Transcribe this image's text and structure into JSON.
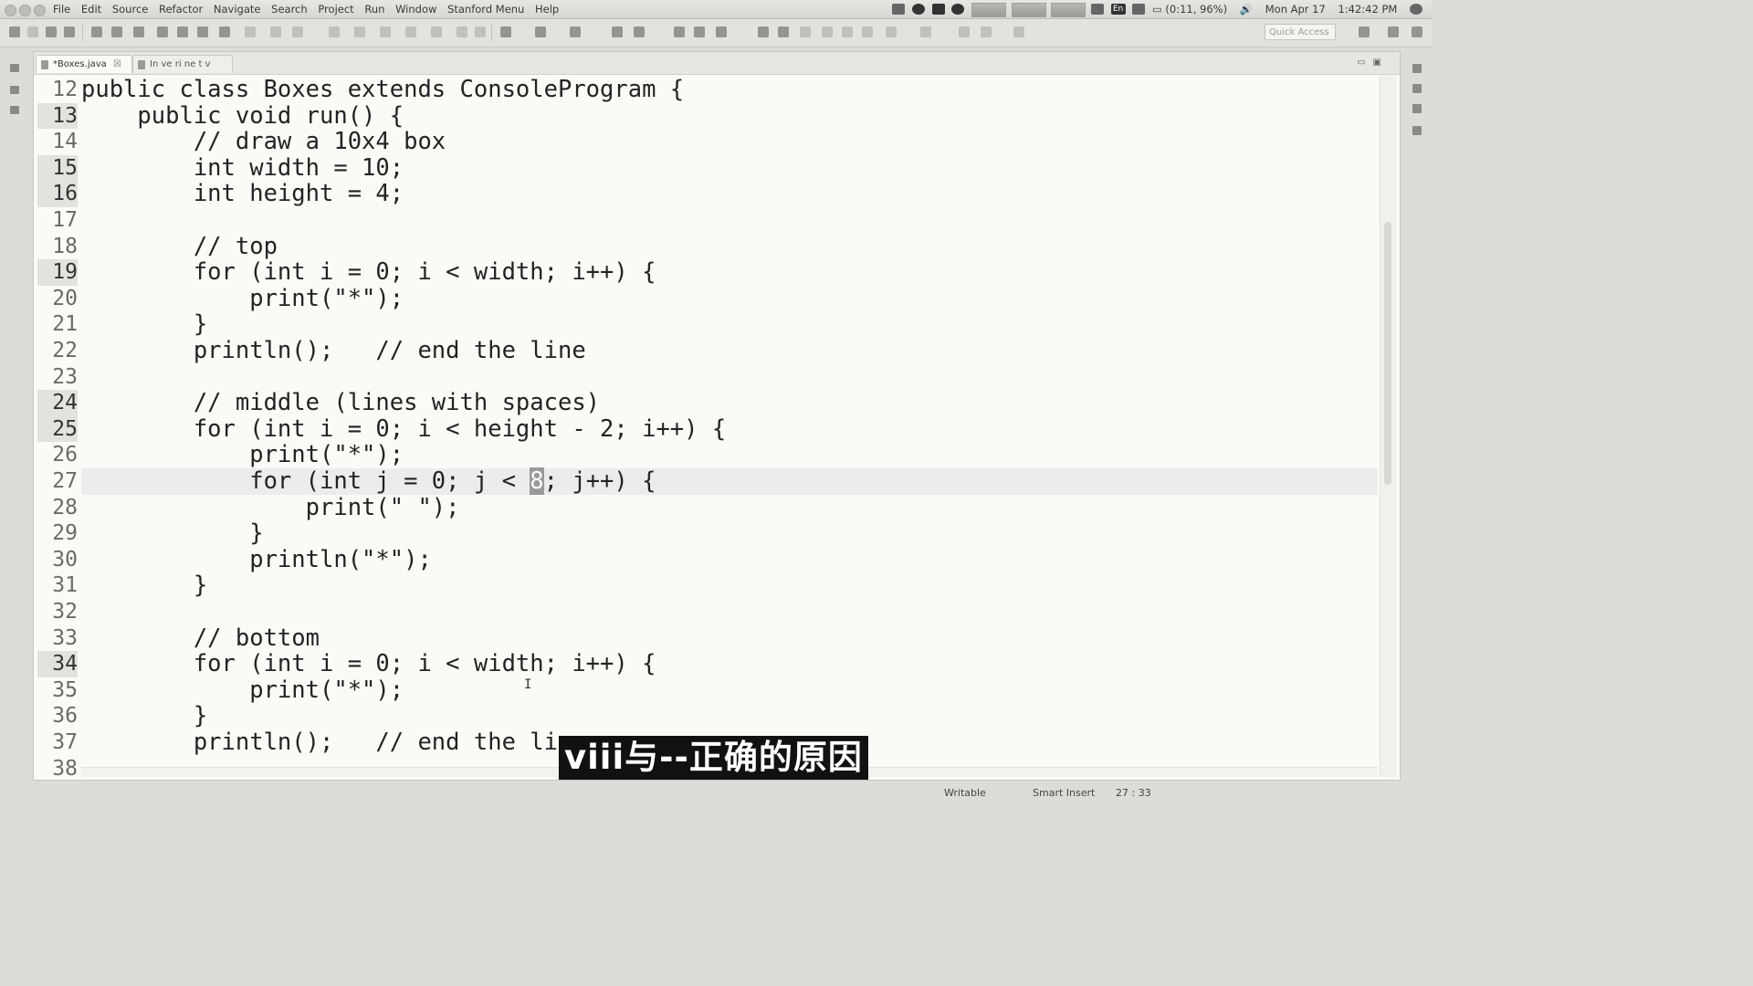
{
  "menubar": {
    "items": [
      "File",
      "Edit",
      "Source",
      "Refactor",
      "Navigate",
      "Search",
      "Project",
      "Run",
      "Window",
      "Stanford Menu",
      "Help"
    ],
    "battery_text": "(0:11, 96%)",
    "date_text": "Mon Apr 17",
    "time_text": "1:42:42 PM",
    "lang_badge": "En"
  },
  "toolbar": {
    "quick_access_placeholder": "Quick Access"
  },
  "tabs": [
    {
      "label": "*Boxes.java",
      "close": "☒"
    },
    {
      "label": "In ve ri ne t v"
    }
  ],
  "editor": {
    "lines": [
      {
        "num": "12",
        "code": "public class Boxes extends ConsoleProgram {"
      },
      {
        "num": "13",
        "code": "    public void run() {"
      },
      {
        "num": "14",
        "code": "        // draw a 10x4 box"
      },
      {
        "num": "15",
        "code": "        int width = 10;"
      },
      {
        "num": "16",
        "code": "        int height = 4;"
      },
      {
        "num": "17",
        "code": ""
      },
      {
        "num": "18",
        "code": "        // top"
      },
      {
        "num": "19",
        "code": "        for (int i = 0; i < width; i++) {"
      },
      {
        "num": "20",
        "code": "            print(\"*\");"
      },
      {
        "num": "21",
        "code": "        }"
      },
      {
        "num": "22",
        "code": "        println();   // end the line"
      },
      {
        "num": "23",
        "code": ""
      },
      {
        "num": "24",
        "code": "        // middle (lines with spaces)"
      },
      {
        "num": "25",
        "code": "        for (int i = 0; i < height - 2; i++) {"
      },
      {
        "num": "26",
        "code": "            print(\"*\");"
      },
      {
        "num": "27",
        "code_pre": "            for (int j = 0; j < ",
        "code_sel": "8",
        "code_post": "; j++) {"
      },
      {
        "num": "28",
        "code": "                print(\" \");"
      },
      {
        "num": "29",
        "code": "            }"
      },
      {
        "num": "30",
        "code": "            println(\"*\");"
      },
      {
        "num": "31",
        "code": "        }"
      },
      {
        "num": "32",
        "code": ""
      },
      {
        "num": "33",
        "code": "        // bottom"
      },
      {
        "num": "34",
        "code": "        for (int i = 0; i < width; i++) {"
      },
      {
        "num": "35",
        "code": "            print(\"*\");"
      },
      {
        "num": "36",
        "code": "        }"
      },
      {
        "num": "37",
        "code": "        println();   // end the line"
      },
      {
        "num": "38",
        "code": ""
      }
    ]
  },
  "subtitle": "viii与--正确的原因",
  "status": {
    "writable": "Writable",
    "insert_mode": "Smart Insert",
    "position": "27 : 33"
  }
}
